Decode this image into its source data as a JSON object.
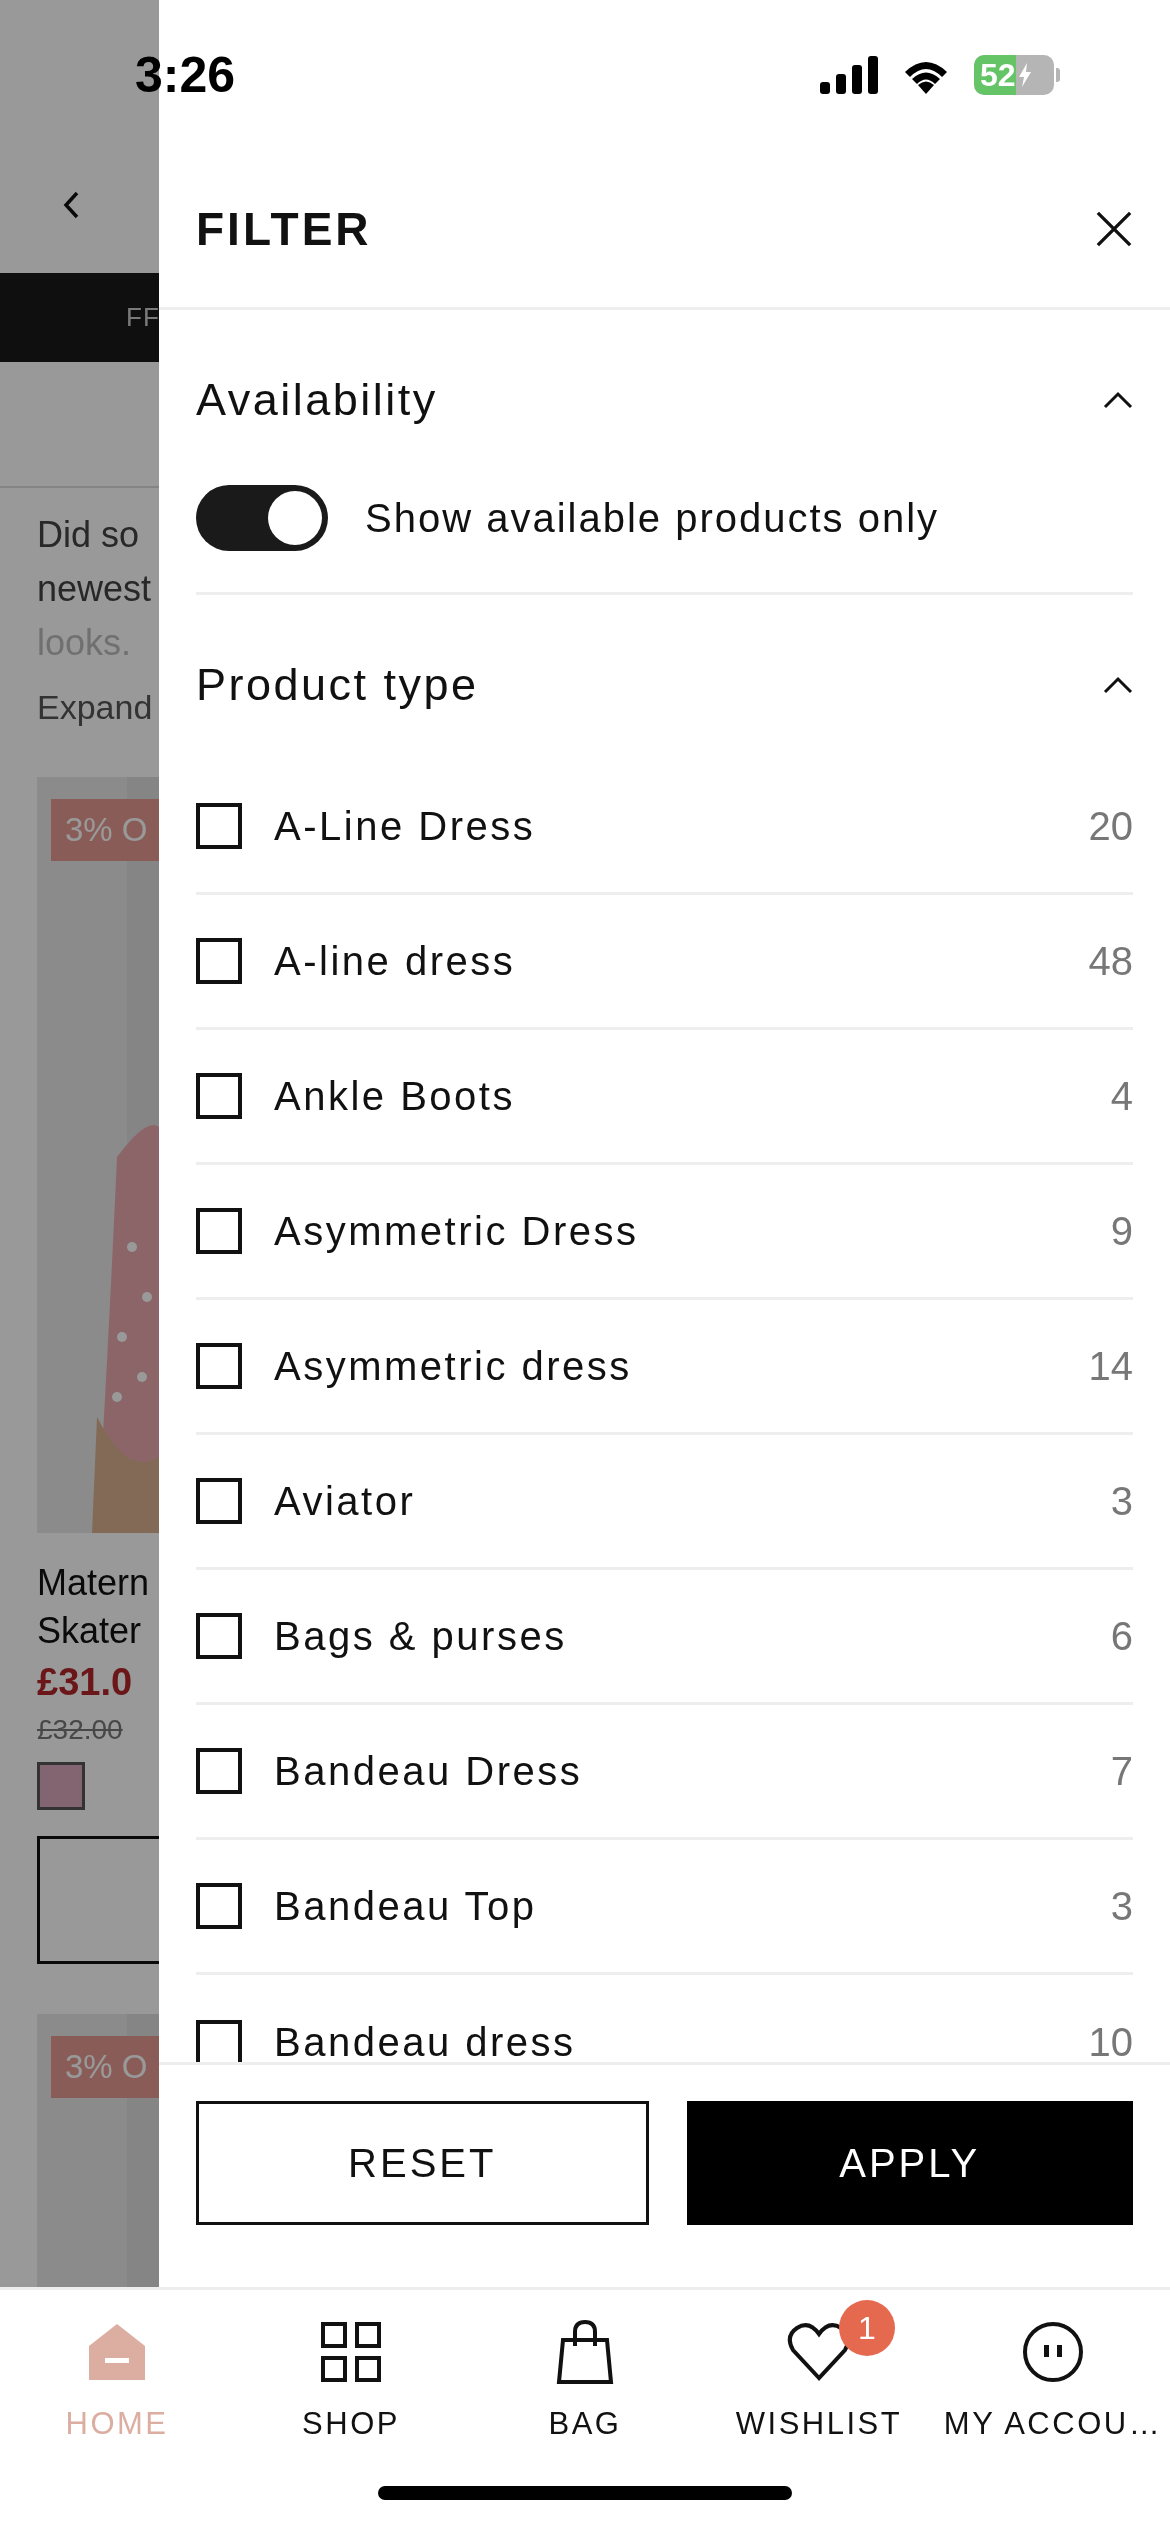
{
  "status_bar": {
    "time": "3:26",
    "battery": "52"
  },
  "background_page": {
    "banner": "FF",
    "description": [
      "Did so",
      "newest",
      "looks."
    ],
    "expand": "Expand",
    "products": [
      {
        "badge": "3% O",
        "name": [
          "Matern",
          "Skater"
        ],
        "price": "£31.0",
        "old_price": "£32.00"
      },
      {
        "badge": "3% O"
      }
    ]
  },
  "filter": {
    "title": "FILTER",
    "sections": [
      {
        "kind": "toggle",
        "title": "Availability",
        "expanded": true,
        "toggle": {
          "label": "Show available products only",
          "on": true
        }
      },
      {
        "kind": "checklist",
        "title": "Product type",
        "expanded": true,
        "options": [
          {
            "label": "A-Line Dress",
            "count": "20",
            "checked": false
          },
          {
            "label": "A-line dress",
            "count": "48",
            "checked": false
          },
          {
            "label": "Ankle Boots",
            "count": "4",
            "checked": false
          },
          {
            "label": "Asymmetric Dress",
            "count": "9",
            "checked": false
          },
          {
            "label": "Asymmetric dress",
            "count": "14",
            "checked": false
          },
          {
            "label": "Aviator",
            "count": "3",
            "checked": false
          },
          {
            "label": "Bags & purses",
            "count": "6",
            "checked": false
          },
          {
            "label": "Bandeau Dress",
            "count": "7",
            "checked": false
          },
          {
            "label": "Bandeau Top",
            "count": "3",
            "checked": false
          },
          {
            "label": "Bandeau dress",
            "count": "10",
            "checked": false
          }
        ]
      }
    ]
  },
  "buttons": {
    "reset": "RESET",
    "apply": "APPLY"
  },
  "nav": [
    {
      "kind": "home",
      "label": "HOME",
      "selected": true
    },
    {
      "kind": "shop",
      "label": "SHOP",
      "selected": false
    },
    {
      "kind": "bag",
      "label": "BAG",
      "selected": false
    },
    {
      "kind": "wishlist",
      "label": "WISHLIST",
      "selected": false,
      "badge": "1"
    },
    {
      "kind": "account",
      "label": "MY ACCOU…",
      "selected": false
    }
  ]
}
